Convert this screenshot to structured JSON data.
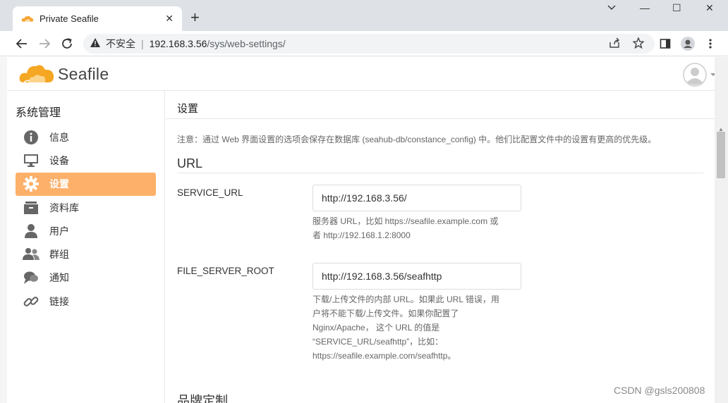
{
  "browser": {
    "tab_title": "Private Seafile",
    "tab_close": "✕",
    "new_tab": "+",
    "window_controls": {
      "minimize": "—",
      "maximize": "☐",
      "close": "✕"
    },
    "address": {
      "security_label": "不安全",
      "separator": "|",
      "host": "192.168.3.56",
      "path": "/sys/web-settings/"
    }
  },
  "app": {
    "brand": "Seafile",
    "accent_color": "#fdb06a"
  },
  "sidebar": {
    "title": "系统管理",
    "items": [
      {
        "label": "信息",
        "icon": "info-icon"
      },
      {
        "label": "设备",
        "icon": "monitor-icon"
      },
      {
        "label": "设置",
        "icon": "gear-icon",
        "active": true
      },
      {
        "label": "资料库",
        "icon": "library-icon"
      },
      {
        "label": "用户",
        "icon": "user-icon"
      },
      {
        "label": "群组",
        "icon": "group-icon"
      },
      {
        "label": "通知",
        "icon": "notification-icon"
      },
      {
        "label": "链接",
        "icon": "link-icon"
      }
    ]
  },
  "main": {
    "title": "设置",
    "notice": "注意：通过 Web 界面设置的选项会保存在数据库 (seahub-db/constance_config) 中。他们比配置文件中的设置有更高的优先级。",
    "section_url": "URL",
    "fields": [
      {
        "label": "SERVICE_URL",
        "value": "http://192.168.3.56/",
        "help": [
          "服务器 URL，比如 https://seafile.example.com 或",
          "者 http://192.168.1.2:8000"
        ]
      },
      {
        "label": "FILE_SERVER_ROOT",
        "value": "http://192.168.3.56/seafhttp",
        "help": [
          "下载/上传文件的内部 URL。如果此 URL 错误，用",
          "户将不能下载/上传文件。如果你配置了",
          "Nginx/Apache， 这个 URL 的值是",
          "“SERVICE_URL/seafhttp”，比如：",
          "https://seafile.example.com/seafhttp。"
        ]
      }
    ],
    "section_brand": "品牌定制"
  },
  "watermark": "CSDN @gsls200808"
}
